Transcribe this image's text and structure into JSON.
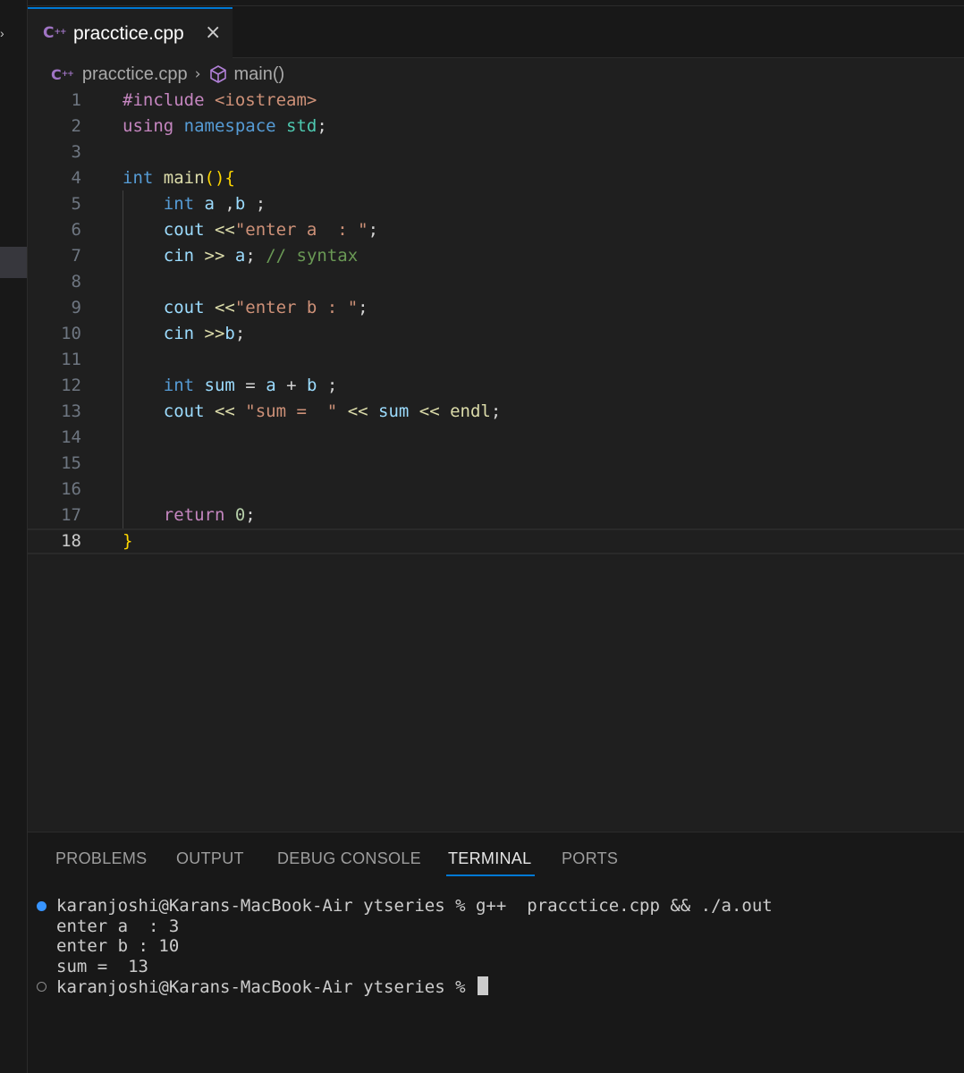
{
  "tab": {
    "title": "pracctice.cpp",
    "icon": "cpp-file-icon",
    "close_glyph": "×"
  },
  "breadcrumb": {
    "file": "pracctice.cpp",
    "symbol": "main()"
  },
  "editor": {
    "current_line": 18,
    "lines": [
      {
        "n": "1",
        "tokens": [
          {
            "t": "#include ",
            "c": "pp"
          },
          {
            "t": "<iostream>",
            "c": "inc"
          }
        ]
      },
      {
        "n": "2",
        "tokens": [
          {
            "t": "using ",
            "c": "kw2"
          },
          {
            "t": "namespace ",
            "c": "kw"
          },
          {
            "t": "std",
            "c": "ns"
          },
          {
            "t": ";",
            "c": "plain"
          }
        ]
      },
      {
        "n": "3",
        "tokens": []
      },
      {
        "n": "4",
        "tokens": [
          {
            "t": "int ",
            "c": "kw"
          },
          {
            "t": "main",
            "c": "fn"
          },
          {
            "t": "(){",
            "c": "br"
          }
        ]
      },
      {
        "n": "5",
        "tokens": [
          {
            "t": "    ",
            "c": "plain"
          },
          {
            "t": "int ",
            "c": "kw"
          },
          {
            "t": "a ",
            "c": "var"
          },
          {
            "t": ",",
            "c": "plain"
          },
          {
            "t": "b ",
            "c": "var"
          },
          {
            "t": ";",
            "c": "plain"
          }
        ]
      },
      {
        "n": "6",
        "tokens": [
          {
            "t": "    ",
            "c": "plain"
          },
          {
            "t": "cout ",
            "c": "var"
          },
          {
            "t": "<<",
            "c": "fn"
          },
          {
            "t": "\"enter a  : \"",
            "c": "str"
          },
          {
            "t": ";",
            "c": "plain"
          }
        ]
      },
      {
        "n": "7",
        "tokens": [
          {
            "t": "    ",
            "c": "plain"
          },
          {
            "t": "cin ",
            "c": "var"
          },
          {
            "t": ">> ",
            "c": "fn"
          },
          {
            "t": "a",
            "c": "var"
          },
          {
            "t": "; ",
            "c": "plain"
          },
          {
            "t": "// syntax",
            "c": "com"
          }
        ]
      },
      {
        "n": "8",
        "tokens": []
      },
      {
        "n": "9",
        "tokens": [
          {
            "t": "    ",
            "c": "plain"
          },
          {
            "t": "cout ",
            "c": "var"
          },
          {
            "t": "<<",
            "c": "fn"
          },
          {
            "t": "\"enter b : \"",
            "c": "str"
          },
          {
            "t": ";",
            "c": "plain"
          }
        ]
      },
      {
        "n": "10",
        "tokens": [
          {
            "t": "    ",
            "c": "plain"
          },
          {
            "t": "cin ",
            "c": "var"
          },
          {
            "t": ">>",
            "c": "fn"
          },
          {
            "t": "b",
            "c": "var"
          },
          {
            "t": ";",
            "c": "plain"
          }
        ]
      },
      {
        "n": "11",
        "tokens": []
      },
      {
        "n": "12",
        "tokens": [
          {
            "t": "    ",
            "c": "plain"
          },
          {
            "t": "int ",
            "c": "kw"
          },
          {
            "t": "sum ",
            "c": "var"
          },
          {
            "t": "= ",
            "c": "plain"
          },
          {
            "t": "a ",
            "c": "var"
          },
          {
            "t": "+ ",
            "c": "plain"
          },
          {
            "t": "b ",
            "c": "var"
          },
          {
            "t": ";",
            "c": "plain"
          }
        ]
      },
      {
        "n": "13",
        "tokens": [
          {
            "t": "    ",
            "c": "plain"
          },
          {
            "t": "cout ",
            "c": "var"
          },
          {
            "t": "<< ",
            "c": "fn"
          },
          {
            "t": "\"sum =  \"",
            "c": "str"
          },
          {
            "t": " << ",
            "c": "fn"
          },
          {
            "t": "sum ",
            "c": "var"
          },
          {
            "t": "<< ",
            "c": "fn"
          },
          {
            "t": "endl",
            "c": "fn"
          },
          {
            "t": ";",
            "c": "plain"
          }
        ]
      },
      {
        "n": "14",
        "tokens": []
      },
      {
        "n": "15",
        "tokens": []
      },
      {
        "n": "16",
        "tokens": []
      },
      {
        "n": "17",
        "tokens": [
          {
            "t": "    ",
            "c": "plain"
          },
          {
            "t": "return ",
            "c": "kw2"
          },
          {
            "t": "0",
            "c": "num"
          },
          {
            "t": ";",
            "c": "plain"
          }
        ]
      },
      {
        "n": "18",
        "tokens": [
          {
            "t": "}",
            "c": "br"
          }
        ]
      }
    ]
  },
  "panel": {
    "tabs": [
      {
        "label": "PROBLEMS",
        "name": "tab-problems"
      },
      {
        "label": "OUTPUT",
        "name": "tab-output"
      },
      {
        "label": "DEBUG CONSOLE",
        "name": "tab-debug-console"
      },
      {
        "label": "TERMINAL",
        "name": "tab-terminal",
        "active": true
      },
      {
        "label": "PORTS",
        "name": "tab-ports"
      }
    ],
    "terminal": [
      {
        "text": "karanjoshi@Karans-MacBook-Air ytseries % g++  pracctice.cpp && ./a.out",
        "marker": "filled"
      },
      {
        "text": "enter a  : 3",
        "marker": "none"
      },
      {
        "text": "enter b : 10",
        "marker": "none"
      },
      {
        "text": "sum =  13",
        "marker": "none"
      },
      {
        "text": "karanjoshi@Karans-MacBook-Air ytseries % ",
        "marker": "hollow",
        "cursor": true
      }
    ]
  },
  "colors": {
    "accent": "#0078d4",
    "terminal_dot": "#3794ff",
    "cpp_icon": "#a074c4"
  }
}
